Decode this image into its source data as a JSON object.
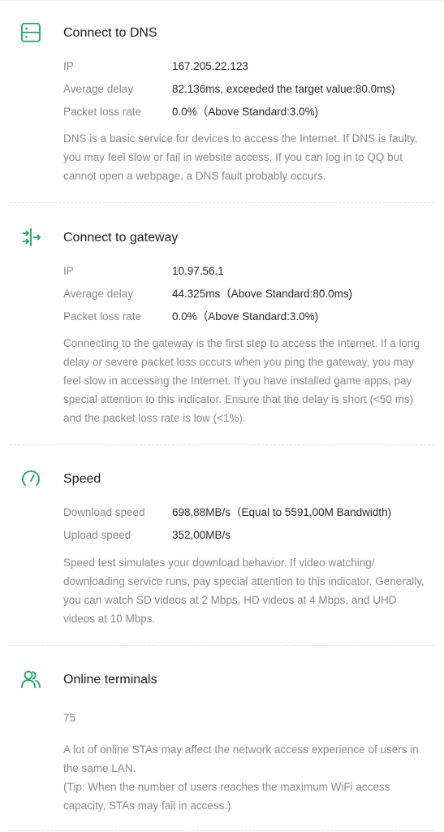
{
  "colors": {
    "accent": "#1aa860",
    "label": "#8a8a8a",
    "text": "#2a2a2a",
    "divider": "#e3e3e3"
  },
  "dns": {
    "icon": "server-icon",
    "title": "Connect to DNS",
    "rows": [
      {
        "label": "IP",
        "value": "167.205.22.123"
      },
      {
        "label": "Average delay",
        "value": "82.136ms, exceeded the target value:80.0ms)"
      },
      {
        "label": "Packet loss rate",
        "value": "0.0%（Above Standard:3.0%)"
      }
    ],
    "description": "DNS is a basic service for devices to access the Internet. If DNS is faulty, you may feel slow or fail in website access. If you can log in to QQ but cannot open a webpage, a DNS fault probably occurs."
  },
  "gateway": {
    "icon": "gateway-icon",
    "title": "Connect to gateway",
    "rows": [
      {
        "label": "IP",
        "value": "10.97.56.1"
      },
      {
        "label": "Average delay",
        "value": "44.325ms（Above Standard:80.0ms)"
      },
      {
        "label": "Packet loss rate",
        "value": "0.0%（Above Standard:3.0%)"
      }
    ],
    "description": "Connecting to the gateway is the first step to access the Internet. If a long delay or severe packet loss occurs when you ping the gateway, you may feel slow in accessing the Internet. If you have installed game apps, pay special attention to this indicator. Ensure that the delay is short (<50 ms) and the packet loss rate is low (<1%)."
  },
  "speed": {
    "icon": "speedometer-icon",
    "title": "Speed",
    "rows": [
      {
        "label": "Download speed",
        "value": "698,88MB/s（Equal to 5591,00M Bandwidth)"
      },
      {
        "label": "Upload speed",
        "value": "352,00MB/s"
      }
    ],
    "description": "Speed test simulates your download behavior. If video watching/ downloading service runs, pay special attention to this indicator. Generally, you can watch SD videos at 2 Mbps, HD videos at 4 Mbps, and UHD videos at 10 Mbps."
  },
  "terminals": {
    "icon": "users-icon",
    "title": "Online terminals",
    "count": "75",
    "description": "A lot of online STAs may affect the network access experience of users in the same LAN.",
    "tip": "(Tip: When the number of users reaches the maximum WiFi access capacity, STAs may fail in access.)"
  }
}
